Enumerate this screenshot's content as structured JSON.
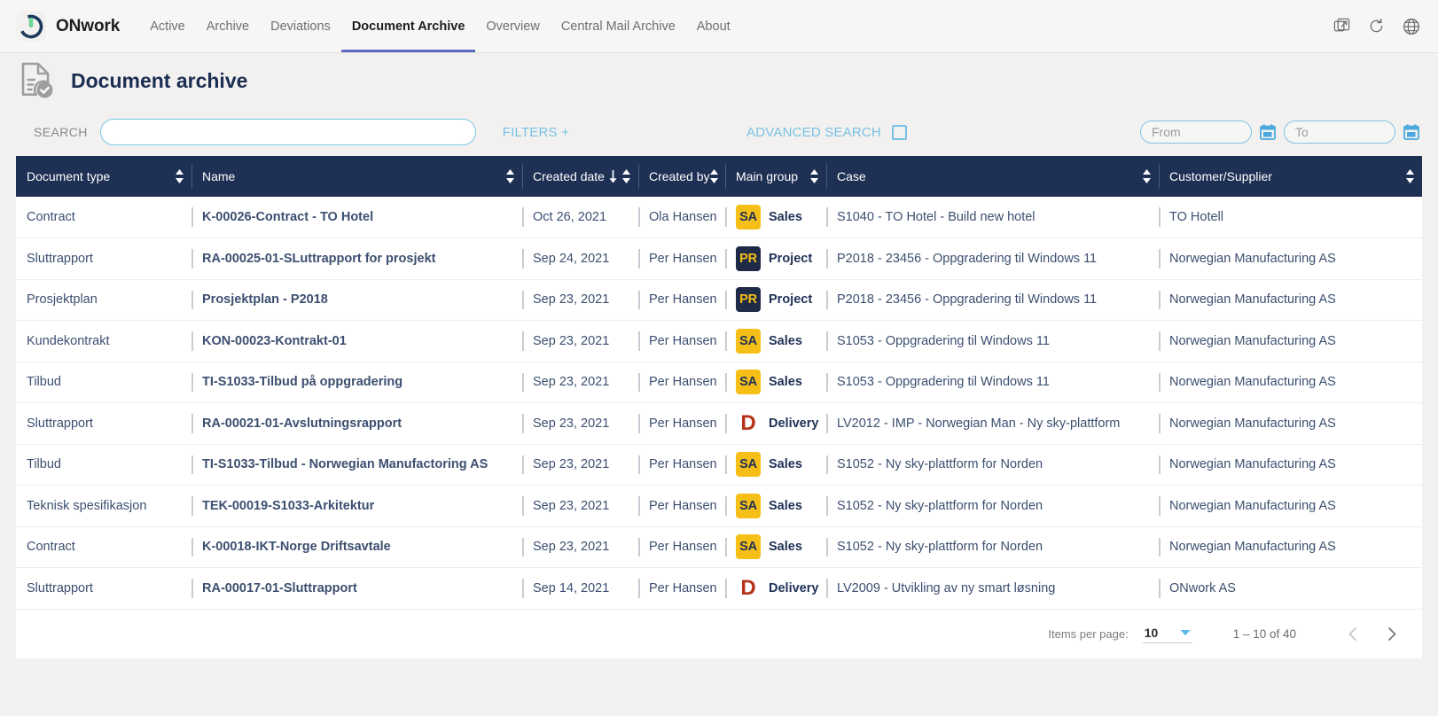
{
  "app": {
    "brand": "ONwork",
    "logo_icon": "power-button-icon",
    "logo_ring_color": "#1b3a5c",
    "logo_bar_color": "#6fd79a"
  },
  "nav": {
    "items": [
      {
        "label": "Active",
        "active": false
      },
      {
        "label": "Archive",
        "active": false
      },
      {
        "label": "Deviations",
        "active": false
      },
      {
        "label": "Document Archive",
        "active": true
      },
      {
        "label": "Overview",
        "active": false
      },
      {
        "label": "Central Mail Archive",
        "active": false
      },
      {
        "label": "About",
        "active": false
      }
    ],
    "active_underline_color": "#5b6bbf",
    "icons": [
      {
        "name": "open-external-icon"
      },
      {
        "name": "refresh-icon"
      },
      {
        "name": "globe-icon"
      }
    ]
  },
  "page": {
    "title": "Document archive",
    "title_icon": "document-check-icon",
    "title_color": "#1a2d52"
  },
  "search": {
    "label": "SEARCH",
    "input_value": "",
    "input_placeholder": "",
    "filters_label": "FILTERS +",
    "advanced_search_label": "ADVANCED SEARCH",
    "advanced_search_checked": false,
    "accent_color": "#79c1e6",
    "date_from": {
      "value": "",
      "placeholder": "From",
      "icon": "calendar-icon"
    },
    "date_to": {
      "value": "",
      "placeholder": "To",
      "icon": "calendar-icon"
    }
  },
  "table": {
    "header_bg": "#1e3054",
    "columns": [
      {
        "key": "document_type",
        "label": "Document type",
        "sortable": true,
        "sorted": false
      },
      {
        "key": "name",
        "label": "Name",
        "sortable": true,
        "sorted": false
      },
      {
        "key": "created_date",
        "label": "Created date",
        "sortable": true,
        "sorted": true,
        "sort_dir": "desc"
      },
      {
        "key": "created_by",
        "label": "Created by",
        "sortable": true,
        "sorted": false
      },
      {
        "key": "main_group",
        "label": "Main group",
        "sortable": true,
        "sorted": false
      },
      {
        "key": "case",
        "label": "Case",
        "sortable": true,
        "sorted": false
      },
      {
        "key": "customer_supplier",
        "label": "Customer/Supplier",
        "sortable": true,
        "sorted": false
      }
    ],
    "rows": [
      {
        "document_type": "Contract",
        "name": "K-00026-Contract - TO Hotel",
        "created_date": "Oct 26, 2021",
        "created_by": "Ola Hansen",
        "group_code": "SA",
        "group_style": "sa",
        "main_group": "Sales",
        "case": "S1040 - TO Hotel - Build new hotel",
        "customer_supplier": "TO Hotell"
      },
      {
        "document_type": "Sluttrapport",
        "name": "RA-00025-01-SLuttrapport for prosjekt",
        "created_date": "Sep 24, 2021",
        "created_by": "Per Hansen",
        "group_code": "PR",
        "group_style": "pr",
        "main_group": "Project",
        "case": "P2018 - 23456 - Oppgradering til Windows 11",
        "customer_supplier": "Norwegian Manufacturing AS"
      },
      {
        "document_type": "Prosjektplan",
        "name": "Prosjektplan - P2018",
        "created_date": "Sep 23, 2021",
        "created_by": "Per Hansen",
        "group_code": "PR",
        "group_style": "pr",
        "main_group": "Project",
        "case": "P2018 - 23456 - Oppgradering til Windows 11",
        "customer_supplier": "Norwegian Manufacturing AS"
      },
      {
        "document_type": "Kundekontrakt",
        "name": "KON-00023-Kontrakt-01",
        "created_date": "Sep 23, 2021",
        "created_by": "Per Hansen",
        "group_code": "SA",
        "group_style": "sa",
        "main_group": "Sales",
        "case": "S1053 - Oppgradering til Windows 11",
        "customer_supplier": "Norwegian Manufacturing AS"
      },
      {
        "document_type": "Tilbud",
        "name": "TI-S1033-Tilbud på oppgradering",
        "created_date": "Sep 23, 2021",
        "created_by": "Per Hansen",
        "group_code": "SA",
        "group_style": "sa",
        "main_group": "Sales",
        "case": "S1053 - Oppgradering til Windows 11",
        "customer_supplier": "Norwegian Manufacturing AS"
      },
      {
        "document_type": "Sluttrapport",
        "name": "RA-00021-01-Avslutningsrapport",
        "created_date": "Sep 23, 2021",
        "created_by": "Per Hansen",
        "group_code": "D",
        "group_style": "d",
        "main_group": "Delivery",
        "case": "LV2012 - IMP - Norwegian Man - Ny sky-plattform",
        "customer_supplier": "Norwegian Manufacturing AS"
      },
      {
        "document_type": "Tilbud",
        "name": "TI-S1033-Tilbud - Norwegian Manufactoring AS",
        "created_date": "Sep 23, 2021",
        "created_by": "Per Hansen",
        "group_code": "SA",
        "group_style": "sa",
        "main_group": "Sales",
        "case": "S1052 - Ny sky-plattform for Norden",
        "customer_supplier": "Norwegian Manufacturing AS"
      },
      {
        "document_type": "Teknisk spesifikasjon",
        "name": "TEK-00019-S1033-Arkitektur",
        "created_date": "Sep 23, 2021",
        "created_by": "Per Hansen",
        "group_code": "SA",
        "group_style": "sa",
        "main_group": "Sales",
        "case": "S1052 - Ny sky-plattform for Norden",
        "customer_supplier": "Norwegian Manufacturing AS"
      },
      {
        "document_type": "Contract",
        "name": "K-00018-IKT-Norge Driftsavtale",
        "created_date": "Sep 23, 2021",
        "created_by": "Per Hansen",
        "group_code": "SA",
        "group_style": "sa",
        "main_group": "Sales",
        "case": "S1052 - Ny sky-plattform for Norden",
        "customer_supplier": "Norwegian Manufacturing AS"
      },
      {
        "document_type": "Sluttrapport",
        "name": "RA-00017-01-Sluttrapport",
        "created_date": "Sep 14, 2021",
        "created_by": "Per Hansen",
        "group_code": "D",
        "group_style": "d",
        "main_group": "Delivery",
        "case": "LV2009 - Utvikling av ny smart løsning",
        "customer_supplier": "ONwork AS"
      }
    ]
  },
  "pagination": {
    "items_per_page_label": "Items per page:",
    "items_per_page_value": "10",
    "range_label": "1 – 10 of 40",
    "prev_icon": "chevron-left-icon",
    "next_icon": "chevron-right-icon",
    "prev_enabled": false,
    "next_enabled": true
  },
  "colors": {
    "badge_sales_bg": "#f6bf18",
    "badge_project_bg": "#1e2a46",
    "badge_delivery_fg": "#b5341b",
    "table_header_bg": "#1e3054",
    "accent_blue": "#79c1e6",
    "page_bg": "#f2f1ef"
  }
}
